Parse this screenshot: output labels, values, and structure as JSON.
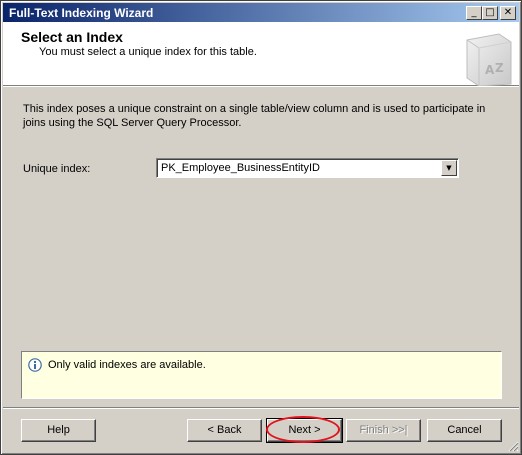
{
  "window": {
    "title": "Full-Text Indexing Wizard",
    "minimize_glyph": "_",
    "maximize_glyph": "□",
    "close_glyph": "✕"
  },
  "header": {
    "title": "Select an Index",
    "subtitle": "You must select a unique index for this table.",
    "graphic_icon": "book-az-icon"
  },
  "body": {
    "description": "This index poses a unique constraint on a single table/view column and is used to participate in joins using the SQL Server Query Processor.",
    "unique_index_label": "Unique index:",
    "unique_index_value": "PK_Employee_BusinessEntityID",
    "dropdown_glyph": "▼"
  },
  "info": {
    "icon": "info-icon",
    "message": "Only valid indexes are available."
  },
  "buttons": {
    "help": "Help",
    "back": "< Back",
    "next": "Next >",
    "finish": "Finish >>|",
    "cancel": "Cancel"
  },
  "colors": {
    "highlight": "#e0141e",
    "info_background": "#ffffe1",
    "title_gradient_start": "#0a246a"
  }
}
